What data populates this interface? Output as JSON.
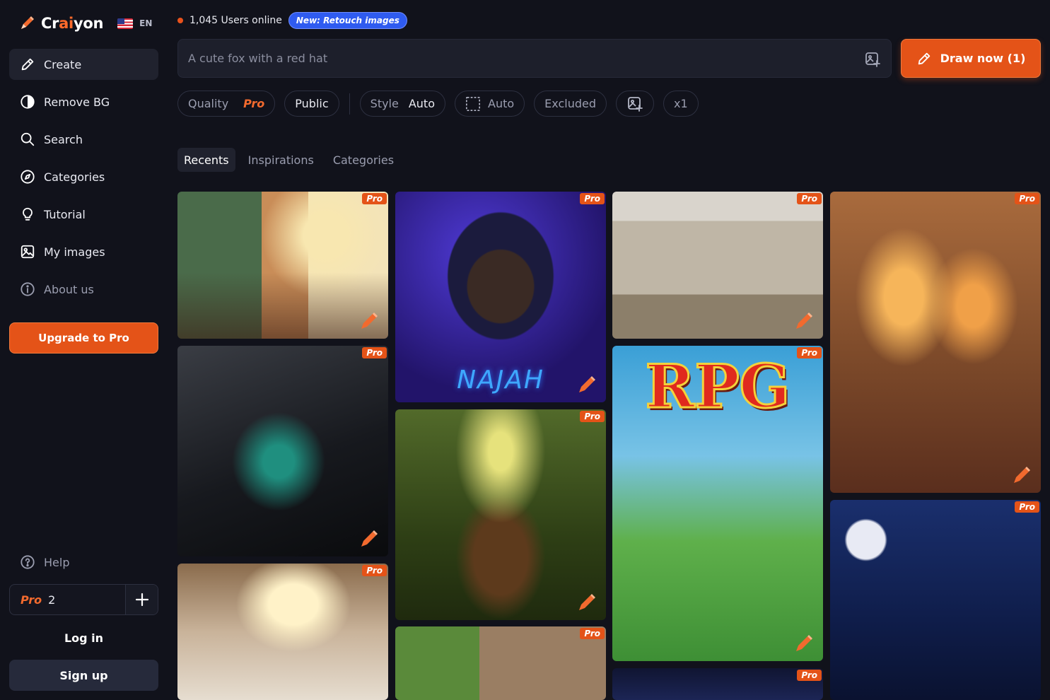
{
  "app": {
    "logo": {
      "prefix": "Cr",
      "highlight": "ai",
      "suffix": "yon"
    },
    "lang": "EN"
  },
  "sidebar": {
    "items": [
      {
        "label": "Create",
        "icon": "pencil-icon"
      },
      {
        "label": "Remove BG",
        "icon": "half-circle-icon"
      },
      {
        "label": "Search",
        "icon": "search-icon"
      },
      {
        "label": "Categories",
        "icon": "compass-icon"
      },
      {
        "label": "Tutorial",
        "icon": "lightbulb-icon"
      },
      {
        "label": "My images",
        "icon": "image-icon"
      },
      {
        "label": "About us",
        "icon": "info-icon"
      }
    ],
    "upgrade_label": "Upgrade to Pro",
    "help_label": "Help",
    "pro_label": "Pro",
    "pro_count": "2",
    "login_label": "Log in",
    "signup_label": "Sign up"
  },
  "header": {
    "online_text": "1,045 Users online",
    "new_badge": "New: Retouch images"
  },
  "prompt": {
    "placeholder": "A cute fox with a red hat",
    "draw_label": "Draw now (1)"
  },
  "options": {
    "quality_label": "Quality",
    "quality_value": "Pro",
    "visibility": "Public",
    "style_label": "Style",
    "style_value": "Auto",
    "aspect_value": "Auto",
    "excluded_label": "Excluded",
    "count_label": "x1"
  },
  "tabs": [
    {
      "label": "Recents",
      "active": true
    },
    {
      "label": "Inspirations",
      "active": false
    },
    {
      "label": "Categories",
      "active": false
    }
  ],
  "gallery": {
    "badge": "Pro",
    "najah_text": "NAJAH",
    "rpg_text": "RPG"
  },
  "colors": {
    "accent": "#e45318",
    "badge_blue": "#2f5bf0",
    "background": "#11121b"
  }
}
